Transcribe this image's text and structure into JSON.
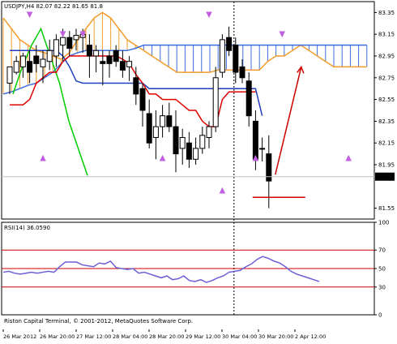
{
  "header": {
    "title": "USDJPY,H4  82.07 82.22 81.65 81.8"
  },
  "indicator": {
    "title": "RSI(14) 36.0590"
  },
  "footer": {
    "copyright": "Riston Capital Terminal, © 2001-2012, MetaQuotes Software Corp."
  },
  "colors": {
    "bull": "#ffffff",
    "bear": "#000000",
    "kijun": "#1f3fbf",
    "tenkan": "#e00000",
    "chikou": "#00cc00",
    "cloud_orange": "#f39c2c",
    "cloud_blue": "#3b6ee0",
    "rsi": "#6b5fd6",
    "level": "#cc0000",
    "arrow": "#d0104a",
    "fractal": "#c060e0",
    "current_bg": "#000000"
  },
  "chart_data": [
    {
      "type": "candlestick",
      "title": "USDJPY,H4  82.07 82.22 81.65 81.8",
      "ylim": [
        81.45,
        83.45
      ],
      "y_ticks": [
        "83.35",
        "83.15",
        "82.95",
        "82.75",
        "82.55",
        "82.35",
        "82.15",
        "81.95",
        "81.55"
      ],
      "current_price": "81.84",
      "candles": [
        {
          "o": 82.7,
          "h": 82.78,
          "l": 82.6,
          "c": 82.85
        },
        {
          "o": 82.8,
          "h": 82.95,
          "l": 82.78,
          "c": 82.9
        },
        {
          "o": 82.85,
          "h": 82.98,
          "l": 82.75,
          "c": 82.95
        },
        {
          "o": 82.9,
          "h": 83.0,
          "l": 82.7,
          "c": 82.8
        },
        {
          "o": 82.95,
          "h": 83.05,
          "l": 82.8,
          "c": 82.88
        },
        {
          "o": 82.85,
          "h": 83.0,
          "l": 82.7,
          "c": 82.92
        },
        {
          "o": 82.9,
          "h": 83.1,
          "l": 82.82,
          "c": 83.0
        },
        {
          "o": 82.95,
          "h": 83.15,
          "l": 82.85,
          "c": 83.1
        },
        {
          "o": 83.05,
          "h": 83.2,
          "l": 82.9,
          "c": 83.12
        },
        {
          "o": 83.12,
          "h": 83.18,
          "l": 82.95,
          "c": 83.02
        },
        {
          "o": 83.1,
          "h": 83.2,
          "l": 83.0,
          "c": 83.14
        },
        {
          "o": 83.12,
          "h": 83.2,
          "l": 82.98,
          "c": 83.15
        },
        {
          "o": 83.05,
          "h": 83.15,
          "l": 82.75,
          "c": 82.95
        },
        {
          "o": 82.95,
          "h": 83.05,
          "l": 82.8,
          "c": 83.0
        },
        {
          "o": 82.9,
          "h": 83.0,
          "l": 82.68,
          "c": 82.88
        },
        {
          "o": 82.95,
          "h": 83.0,
          "l": 82.75,
          "c": 82.88
        },
        {
          "o": 83.0,
          "h": 83.05,
          "l": 82.85,
          "c": 82.9
        },
        {
          "o": 82.9,
          "h": 83.0,
          "l": 82.75,
          "c": 82.82
        },
        {
          "o": 82.85,
          "h": 82.95,
          "l": 82.72,
          "c": 82.9
        },
        {
          "o": 82.75,
          "h": 82.85,
          "l": 82.5,
          "c": 82.6
        },
        {
          "o": 82.65,
          "h": 82.7,
          "l": 82.3,
          "c": 82.45
        },
        {
          "o": 82.42,
          "h": 82.55,
          "l": 82.1,
          "c": 82.15
        },
        {
          "o": 82.2,
          "h": 82.45,
          "l": 82.0,
          "c": 82.3
        },
        {
          "o": 82.3,
          "h": 82.5,
          "l": 82.2,
          "c": 82.4
        },
        {
          "o": 82.4,
          "h": 82.52,
          "l": 82.25,
          "c": 82.3
        },
        {
          "o": 82.3,
          "h": 82.45,
          "l": 81.88,
          "c": 82.05
        },
        {
          "o": 82.1,
          "h": 82.28,
          "l": 81.95,
          "c": 82.2
        },
        {
          "o": 82.15,
          "h": 82.25,
          "l": 81.92,
          "c": 82.0
        },
        {
          "o": 82.0,
          "h": 82.2,
          "l": 81.95,
          "c": 82.1
        },
        {
          "o": 82.1,
          "h": 82.3,
          "l": 82.05,
          "c": 82.22
        },
        {
          "o": 82.2,
          "h": 82.35,
          "l": 82.1,
          "c": 82.3
        },
        {
          "o": 82.3,
          "h": 82.85,
          "l": 82.25,
          "c": 82.75
        },
        {
          "o": 82.8,
          "h": 83.15,
          "l": 82.75,
          "c": 83.1
        },
        {
          "o": 83.12,
          "h": 83.22,
          "l": 82.95,
          "c": 83.0
        },
        {
          "o": 83.05,
          "h": 83.12,
          "l": 82.7,
          "c": 82.8
        },
        {
          "o": 82.85,
          "h": 82.92,
          "l": 82.7,
          "c": 82.75
        },
        {
          "o": 82.72,
          "h": 82.8,
          "l": 82.3,
          "c": 82.4
        },
        {
          "o": 82.35,
          "h": 82.45,
          "l": 81.9,
          "c": 82.0
        },
        {
          "o": 82.1,
          "h": 82.2,
          "l": 81.98,
          "c": 82.1
        },
        {
          "o": 82.05,
          "h": 82.22,
          "l": 81.55,
          "c": 81.8
        }
      ],
      "tenkan": [
        82.5,
        82.5,
        82.5,
        82.55,
        82.7,
        82.75,
        82.8,
        82.8,
        82.9,
        82.95,
        82.95,
        82.95,
        82.95,
        82.95,
        82.95,
        82.95,
        82.95,
        82.92,
        82.88,
        82.78,
        82.7,
        82.6,
        82.6,
        82.55,
        82.55,
        82.55,
        82.5,
        82.45,
        82.45,
        82.35,
        82.3,
        82.3,
        82.55,
        82.62,
        82.62,
        82.62,
        82.62,
        82.62
      ],
      "kijun": [
        83.0,
        83.0,
        83.0,
        83.0,
        83.0,
        83.0,
        83.0,
        83.0,
        82.95,
        82.85,
        82.72,
        82.7,
        82.7,
        82.7,
        82.7,
        82.7,
        82.7,
        82.7,
        82.7,
        82.7,
        82.7,
        82.65,
        82.65,
        82.65,
        82.65,
        82.65,
        82.65,
        82.65,
        82.65,
        82.65,
        82.65,
        82.65,
        82.65,
        82.65,
        82.65,
        82.65,
        82.65,
        82.65,
        82.4
      ],
      "chikou": [
        82.6,
        82.85,
        83.05,
        83.2,
        82.95,
        82.7,
        82.35,
        82.1,
        81.85
      ],
      "senkou_a": [
        83.3,
        83.2,
        83.1,
        83.05,
        83.0,
        82.98,
        82.95,
        82.92,
        82.98,
        83.1,
        83.2,
        83.3,
        83.35,
        83.3,
        83.2,
        83.1,
        83.05,
        83.0,
        82.95,
        82.9,
        82.85,
        82.8,
        82.8,
        82.8,
        82.8,
        82.8,
        82.82,
        82.82,
        82.82,
        82.82,
        82.82,
        82.82,
        82.9,
        82.95,
        82.95,
        83.0,
        83.05,
        83.0,
        82.95,
        82.9,
        82.85,
        82.85,
        82.85,
        82.85,
        82.85
      ],
      "senkou_b": [
        82.6,
        82.62,
        82.65,
        82.68,
        82.7,
        82.75,
        82.8,
        82.88,
        82.95,
        82.98,
        83.0,
        83.0,
        83.0,
        83.0,
        83.0,
        83.0,
        83.02,
        83.05,
        83.05,
        83.05,
        83.05,
        83.05,
        83.05,
        83.05,
        83.05,
        83.05,
        83.05,
        83.05,
        83.05,
        83.05,
        83.05,
        83.05,
        83.05,
        83.05,
        83.05,
        83.05,
        83.05,
        83.05,
        83.05,
        83.05,
        83.05,
        83.05,
        83.05,
        83.05,
        83.05
      ],
      "up_fractals": [
        3,
        8,
        11,
        30,
        41
      ],
      "down_fractals": [
        5,
        23,
        32,
        37,
        51
      ],
      "forecast_line_from": 81.65,
      "forecast_line_to": 82.85,
      "support_level": 81.65,
      "x_labels": [
        "26 Mar 2012",
        "26 Mar 20:00",
        "27 Mar 12:00",
        "28 Mar 04:00",
        "28 Mar 20:00",
        "29 Mar 12:00",
        "30 Mar 04:00",
        "30 Mar 20:00",
        "2 Apr 12:00"
      ],
      "vertical_marker_index": 34
    },
    {
      "type": "line",
      "title": "RSI(14) 36.0590",
      "ylim": [
        0,
        100
      ],
      "levels": [
        70,
        50,
        30
      ],
      "y_ticks": [
        "100",
        "70",
        "50",
        "30",
        "0"
      ],
      "values": [
        46,
        47,
        45,
        44,
        45,
        46,
        45,
        46,
        47,
        46,
        52,
        57,
        57,
        57,
        54,
        53,
        52,
        56,
        55,
        58,
        51,
        50,
        49,
        50,
        45,
        46,
        44,
        42,
        40,
        42,
        38,
        39,
        42,
        37,
        36,
        38,
        35,
        37,
        40,
        42,
        46,
        47,
        48,
        52,
        55,
        60,
        63,
        61,
        58,
        56,
        52,
        47,
        44,
        42,
        40,
        38,
        36
      ]
    }
  ]
}
